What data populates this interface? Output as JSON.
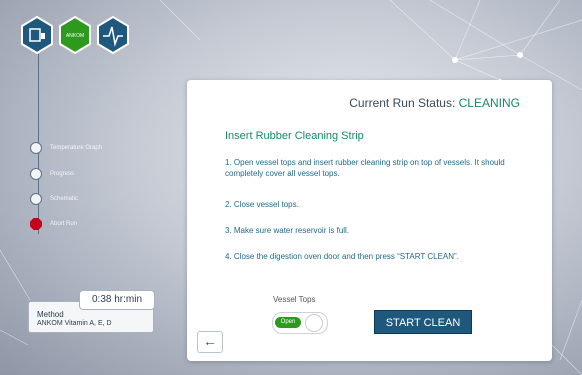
{
  "logos": [
    {
      "name": "vessel-icon",
      "color": "#1f587d"
    },
    {
      "name": "ankom-logo",
      "text": "ANKOM",
      "color": "#2e9a1d"
    },
    {
      "name": "waveform-icon",
      "color": "#1f587d"
    }
  ],
  "sidebar": {
    "items": [
      {
        "label": "Temperature Graph",
        "icon": "circle"
      },
      {
        "label": "Progress",
        "icon": "circle"
      },
      {
        "label": "Schematic",
        "icon": "circle"
      },
      {
        "label": "Abort Run",
        "icon": "stop-octagon",
        "color": "#c4001a"
      }
    ]
  },
  "method": {
    "label": "Method",
    "value": "ANKOM Vitamin A, E, D"
  },
  "timer": {
    "value": "0:38 hr:min"
  },
  "panel": {
    "status_prefix": "Current Run Status: ",
    "status_value": "CLEANING",
    "title": "Insert Rubber Cleaning Strip",
    "steps": [
      "1. Open vessel tops and insert rubber cleaning strip on top of vessels. It should completely cover all vessel tops.",
      "2. Close vessel tops.",
      "3. Make sure water reservoir is full.",
      "4. Close the digestion oven door and then press “START CLEAN”."
    ],
    "vessel_tops_label": "Vessel Tops",
    "toggle_label": "Open",
    "start_button": "START CLEAN",
    "back_icon": "←"
  },
  "colors": {
    "accent_green": "#168a6d",
    "brand_blue": "#1f587d",
    "toggle_green": "#2e9a1d",
    "abort_red": "#c4001a"
  }
}
